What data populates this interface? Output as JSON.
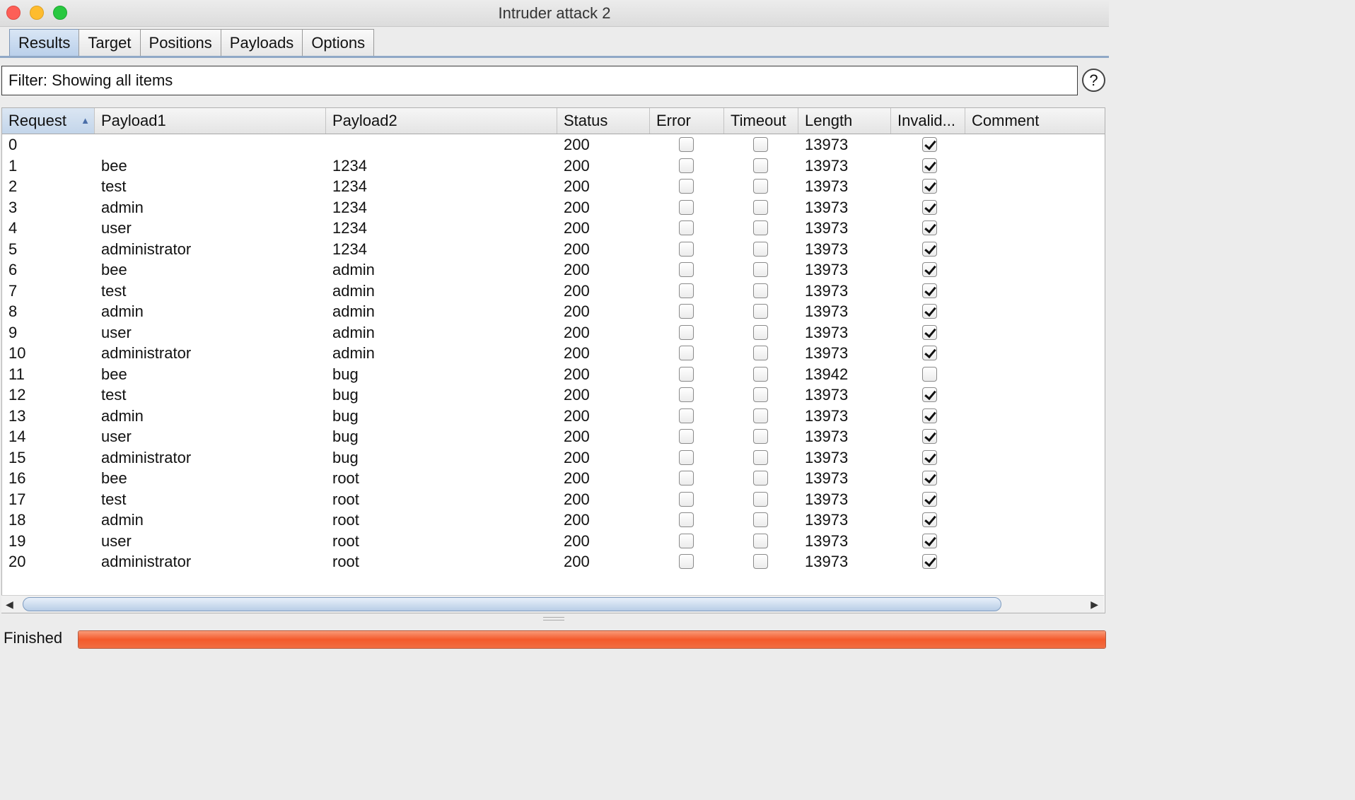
{
  "window": {
    "title": "Intruder attack 2"
  },
  "tabs": [
    {
      "label": "Results",
      "active": true
    },
    {
      "label": "Target",
      "active": false
    },
    {
      "label": "Positions",
      "active": false
    },
    {
      "label": "Payloads",
      "active": false
    },
    {
      "label": "Options",
      "active": false
    }
  ],
  "filter": {
    "text": "Filter: Showing all items",
    "help_label": "?"
  },
  "table": {
    "sort_indicator": "▲",
    "columns": [
      "Request",
      "Payload1",
      "Payload2",
      "Status",
      "Error",
      "Timeout",
      "Length",
      "Invalid...",
      "Comment"
    ],
    "rows": [
      {
        "request": "0",
        "payload1": "",
        "payload2": "",
        "status": "200",
        "error": false,
        "timeout": false,
        "length": "13973",
        "invalid": true,
        "comment": ""
      },
      {
        "request": "1",
        "payload1": "bee",
        "payload2": "1234",
        "status": "200",
        "error": false,
        "timeout": false,
        "length": "13973",
        "invalid": true,
        "comment": ""
      },
      {
        "request": "2",
        "payload1": "test",
        "payload2": "1234",
        "status": "200",
        "error": false,
        "timeout": false,
        "length": "13973",
        "invalid": true,
        "comment": ""
      },
      {
        "request": "3",
        "payload1": "admin",
        "payload2": "1234",
        "status": "200",
        "error": false,
        "timeout": false,
        "length": "13973",
        "invalid": true,
        "comment": ""
      },
      {
        "request": "4",
        "payload1": "user",
        "payload2": "1234",
        "status": "200",
        "error": false,
        "timeout": false,
        "length": "13973",
        "invalid": true,
        "comment": ""
      },
      {
        "request": "5",
        "payload1": "administrator",
        "payload2": "1234",
        "status": "200",
        "error": false,
        "timeout": false,
        "length": "13973",
        "invalid": true,
        "comment": ""
      },
      {
        "request": "6",
        "payload1": "bee",
        "payload2": "admin",
        "status": "200",
        "error": false,
        "timeout": false,
        "length": "13973",
        "invalid": true,
        "comment": ""
      },
      {
        "request": "7",
        "payload1": "test",
        "payload2": "admin",
        "status": "200",
        "error": false,
        "timeout": false,
        "length": "13973",
        "invalid": true,
        "comment": ""
      },
      {
        "request": "8",
        "payload1": "admin",
        "payload2": "admin",
        "status": "200",
        "error": false,
        "timeout": false,
        "length": "13973",
        "invalid": true,
        "comment": ""
      },
      {
        "request": "9",
        "payload1": "user",
        "payload2": "admin",
        "status": "200",
        "error": false,
        "timeout": false,
        "length": "13973",
        "invalid": true,
        "comment": ""
      },
      {
        "request": "10",
        "payload1": "administrator",
        "payload2": "admin",
        "status": "200",
        "error": false,
        "timeout": false,
        "length": "13973",
        "invalid": true,
        "comment": ""
      },
      {
        "request": "11",
        "payload1": "bee",
        "payload2": "bug",
        "status": "200",
        "error": false,
        "timeout": false,
        "length": "13942",
        "invalid": false,
        "comment": ""
      },
      {
        "request": "12",
        "payload1": "test",
        "payload2": "bug",
        "status": "200",
        "error": false,
        "timeout": false,
        "length": "13973",
        "invalid": true,
        "comment": ""
      },
      {
        "request": "13",
        "payload1": "admin",
        "payload2": "bug",
        "status": "200",
        "error": false,
        "timeout": false,
        "length": "13973",
        "invalid": true,
        "comment": ""
      },
      {
        "request": "14",
        "payload1": "user",
        "payload2": "bug",
        "status": "200",
        "error": false,
        "timeout": false,
        "length": "13973",
        "invalid": true,
        "comment": ""
      },
      {
        "request": "15",
        "payload1": "administrator",
        "payload2": "bug",
        "status": "200",
        "error": false,
        "timeout": false,
        "length": "13973",
        "invalid": true,
        "comment": ""
      },
      {
        "request": "16",
        "payload1": "bee",
        "payload2": "root",
        "status": "200",
        "error": false,
        "timeout": false,
        "length": "13973",
        "invalid": true,
        "comment": ""
      },
      {
        "request": "17",
        "payload1": "test",
        "payload2": "root",
        "status": "200",
        "error": false,
        "timeout": false,
        "length": "13973",
        "invalid": true,
        "comment": ""
      },
      {
        "request": "18",
        "payload1": "admin",
        "payload2": "root",
        "status": "200",
        "error": false,
        "timeout": false,
        "length": "13973",
        "invalid": true,
        "comment": ""
      },
      {
        "request": "19",
        "payload1": "user",
        "payload2": "root",
        "status": "200",
        "error": false,
        "timeout": false,
        "length": "13973",
        "invalid": true,
        "comment": ""
      },
      {
        "request": "20",
        "payload1": "administrator",
        "payload2": "root",
        "status": "200",
        "error": false,
        "timeout": false,
        "length": "13973",
        "invalid": true,
        "comment": ""
      }
    ]
  },
  "status_bar": {
    "text": "Finished",
    "progress": 1.0,
    "progress_color": "#f45a2c"
  },
  "icons": {
    "scroll_left": "◀",
    "scroll_right": "▶"
  }
}
